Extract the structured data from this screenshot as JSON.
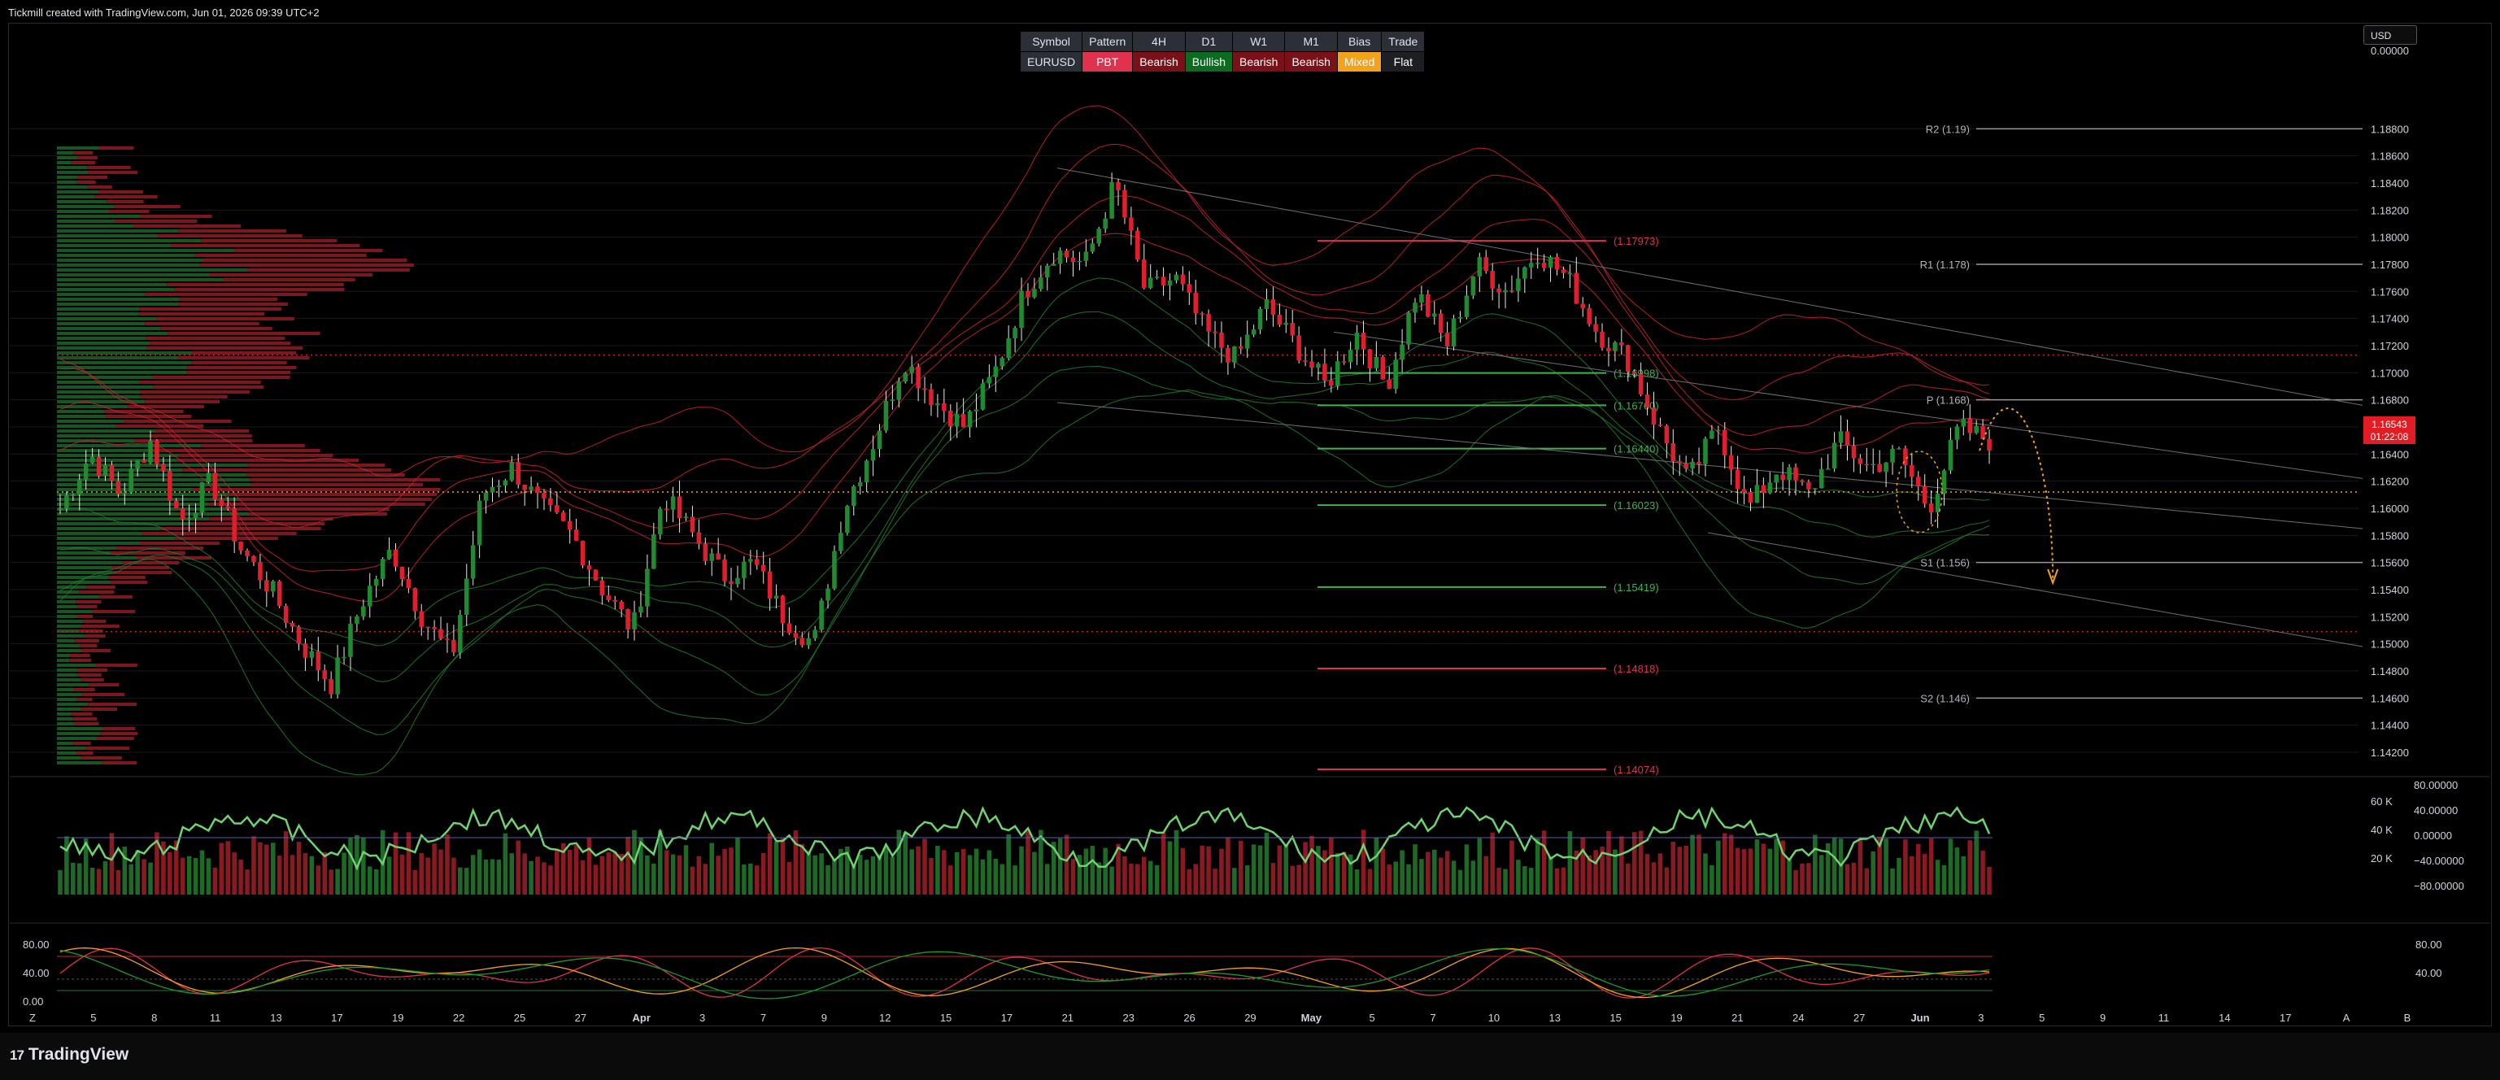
{
  "header": {
    "watermark": "Tickmill created with TradingView.com, Jun 01, 2026 09:39 UTC+2"
  },
  "currency_button": "USD",
  "footer": {
    "logo_mark": "17",
    "logo_text": "TradingView"
  },
  "bias_table": {
    "headers": [
      "Symbol",
      "Pattern",
      "4H",
      "D1",
      "W1",
      "M1",
      "Bias",
      "Trade"
    ],
    "values": [
      {
        "text": "EURUSD",
        "style": "sym"
      },
      {
        "text": "PBT",
        "style": "pbt"
      },
      {
        "text": "Bearish",
        "style": "bear"
      },
      {
        "text": "Bullish",
        "style": "bull"
      },
      {
        "text": "Bearish",
        "style": "bear"
      },
      {
        "text": "Bearish",
        "style": "bear"
      },
      {
        "text": "Mixed",
        "style": "mixed"
      },
      {
        "text": "Flat",
        "style": "flat"
      }
    ]
  },
  "colors": {
    "bull": "#1e8c2e",
    "bear": "#e01e2d",
    "ribbon_red": "#c2222e",
    "ribbon_green": "#1f7a2b",
    "orange": "#f5a21b",
    "level": "#9a9a9a",
    "grid": "#1a1a1a",
    "axis_text": "#d1d4dc",
    "price_tag": "#e31b23"
  },
  "chart_data": {
    "type": "candlestick",
    "symbol": "EURUSD",
    "y_axis": {
      "min": 1.1405,
      "max": 1.1885,
      "ticks": [
        "1.18800",
        "1.18600",
        "1.18400",
        "1.18200",
        "1.18000",
        "1.17800",
        "1.17600",
        "1.17400",
        "1.17200",
        "1.17000",
        "1.16800",
        "1.16600",
        "1.16400",
        "1.16200",
        "1.16000",
        "1.15800",
        "1.15600",
        "1.15400",
        "1.15200",
        "1.15000",
        "1.14800",
        "1.14600",
        "1.14400",
        "1.14200"
      ],
      "top_partial": "0.00000"
    },
    "x_axis": {
      "labels": [
        "Z",
        "5",
        "8",
        "11",
        "13",
        "17",
        "19",
        "22",
        "25",
        "27",
        "Apr",
        "3",
        "7",
        "9",
        "12",
        "15",
        "17",
        "21",
        "23",
        "26",
        "29",
        "May",
        "5",
        "7",
        "10",
        "13",
        "15",
        "19",
        "21",
        "24",
        "27",
        "Jun",
        "3",
        "5",
        "9",
        "11",
        "14",
        "17",
        "A",
        "B"
      ],
      "bold_labels": [
        "Apr",
        "May",
        "Jun"
      ]
    },
    "price_anchors": [
      1.16,
      1.164,
      1.161,
      1.165,
      1.159,
      1.162,
      1.157,
      1.154,
      1.15,
      1.147,
      1.153,
      1.157,
      1.152,
      1.149,
      1.161,
      1.163,
      1.16,
      1.158,
      1.154,
      1.151,
      1.161,
      1.158,
      1.155,
      1.156,
      1.152,
      1.15,
      1.16,
      1.165,
      1.171,
      1.168,
      1.166,
      1.17,
      1.176,
      1.179,
      1.178,
      1.184,
      1.176,
      1.177,
      1.173,
      1.171,
      1.175,
      1.172,
      1.169,
      1.173,
      1.169,
      1.176,
      1.172,
      1.178,
      1.176,
      1.179,
      1.177,
      1.173,
      1.171,
      1.166,
      1.162,
      1.166,
      1.16,
      1.163,
      1.161,
      1.165,
      1.163,
      1.164,
      1.16,
      1.166,
      1.165
    ],
    "current_price": {
      "price": "1.16543",
      "countdown": "01:22:08"
    },
    "pivots": [
      {
        "label": "R2 (1.19)",
        "value": 1.188
      },
      {
        "label": "R1 (1.178)",
        "value": 1.178
      },
      {
        "label": "P (1.168)",
        "value": 1.168
      },
      {
        "label": "S1 (1.156)",
        "value": 1.156
      },
      {
        "label": "S2 (1.146)",
        "value": 1.146
      }
    ],
    "fib_levels": [
      {
        "label": "(1.17973)",
        "value": 1.17973,
        "color": "red"
      },
      {
        "label": "(1.16998)",
        "value": 1.16998,
        "color": "green"
      },
      {
        "label": "(1.16760)",
        "value": 1.1676,
        "color": "green"
      },
      {
        "label": "(1.16440)",
        "value": 1.1644,
        "color": "green"
      },
      {
        "label": "(1.16023)",
        "value": 1.16023,
        "color": "green"
      },
      {
        "label": "(1.15419)",
        "value": 1.15419,
        "color": "green"
      },
      {
        "label": "(1.14818)",
        "value": 1.14818,
        "color": "red"
      },
      {
        "label": "(1.14074)",
        "value": 1.14074,
        "color": "red"
      }
    ],
    "dotted_levels": [
      1.1713,
      1.1612,
      1.1509
    ],
    "volume_pane": {
      "left_ticks": [
        "60 K",
        "40 K",
        "20 K"
      ],
      "right_ticks": [
        "80.00000",
        "40.00000",
        "0.00000",
        "−40.00000",
        "−80.00000"
      ]
    },
    "stochastic_pane": {
      "left_ticks": [
        "80.00",
        "40.00",
        "0.00"
      ],
      "right_ticks": [
        "80.00",
        "40.00"
      ]
    }
  }
}
